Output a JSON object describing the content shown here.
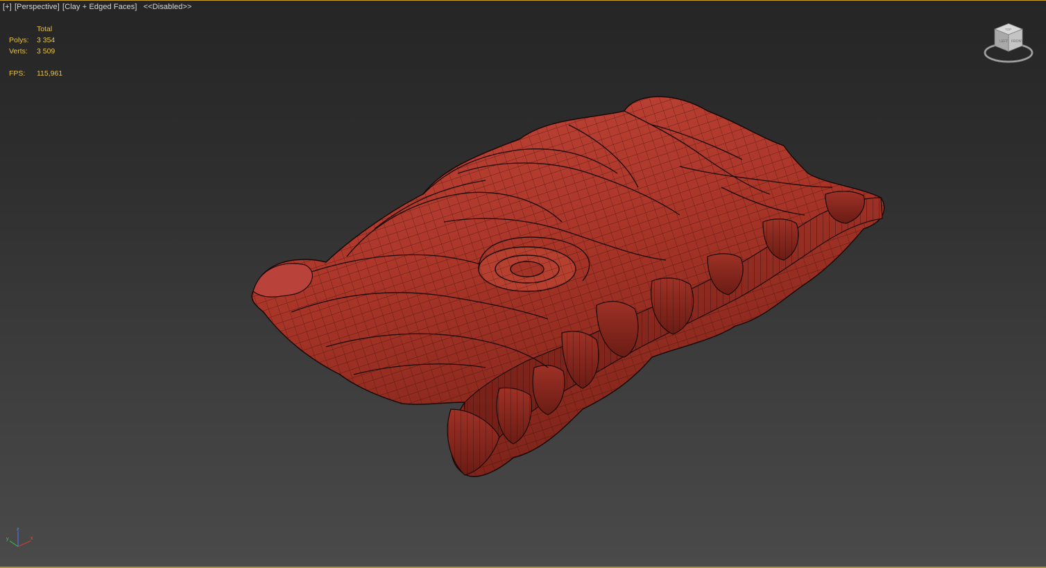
{
  "viewport": {
    "label_menu": {
      "plus": "[+]",
      "view": "[Perspective]",
      "shading": "[Clay + Edged Faces]",
      "state": "<<Disabled>>"
    },
    "stats": {
      "header": "Total",
      "polys_label": "Polys:",
      "polys_value": "3 354",
      "verts_label": "Verts:",
      "verts_value": "3 509",
      "fps_label": "FPS:",
      "fps_value": "115,961"
    },
    "viewcube": {
      "faces": [
        "TOP",
        "LEFT",
        "FRONT"
      ]
    },
    "axis_tripod": {
      "x": "x",
      "y": "y",
      "z": "z"
    }
  },
  "colors": {
    "accent_border": "#c9a227",
    "stats_text": "#e6c24a",
    "clay_model": "#b03a2e",
    "wire_edges": "#1a0806"
  },
  "icons": [
    "viewcube-icon",
    "axis-tripod-icon"
  ]
}
